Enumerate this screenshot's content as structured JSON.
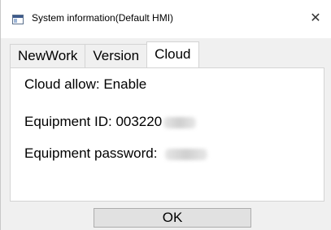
{
  "window": {
    "title": "System information(Default HMI)",
    "close_label": "✕"
  },
  "tabs": [
    {
      "label": "NewWork",
      "active": false
    },
    {
      "label": "Version",
      "active": false
    },
    {
      "label": "Cloud",
      "active": true
    }
  ],
  "cloud": {
    "cloud_allow": "Cloud allow: Enable",
    "equipment_id": "Equipment ID: 003220",
    "equipment_password": "Equipment password:"
  },
  "footer": {
    "ok_label": "OK"
  },
  "icons": {
    "app": "window-app-icon",
    "close": "close-icon"
  }
}
